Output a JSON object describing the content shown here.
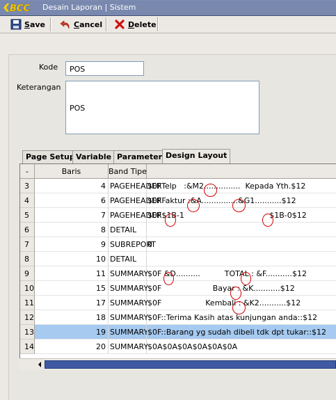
{
  "window": {
    "title": "Desain Laporan | Sistem",
    "logo_text": "BCC"
  },
  "toolbar": {
    "save_label": "Save",
    "save_mnemonic": "S",
    "save_rest": "ave",
    "cancel_mnemonic": "C",
    "cancel_rest": "ancel",
    "delete_mnemonic": "D",
    "delete_rest": "elete"
  },
  "form": {
    "kode_label": "Kode",
    "kode_value": "POS",
    "keterangan_label": "Keterangan",
    "keterangan_value": "POS"
  },
  "tabs": [
    {
      "label": "Page Setup",
      "active": false
    },
    {
      "label": "Variable",
      "active": false
    },
    {
      "label": "Parameter",
      "active": false
    },
    {
      "label": "Design Layout",
      "active": true
    }
  ],
  "grid": {
    "headers": {
      "rownum": "-",
      "baris": "Baris",
      "band": "Band Tipe",
      "text": ""
    },
    "rows": [
      {
        "n": "3",
        "baris": "4",
        "band": "PAGEHEADER",
        "text": "$0FTelp   :&M2...............  Kepada Yth.$12"
      },
      {
        "n": "4",
        "baris": "6",
        "band": "PAGEHEADER",
        "text": "$0FFaktur :&A...............&G1...........$12"
      },
      {
        "n": "5",
        "baris": "7",
        "band": "PAGEHEADER",
        "text": "$0F$1B-1                                   $1B-0$12"
      },
      {
        "n": "6",
        "baris": "8",
        "band": "DETAIL",
        "text": ""
      },
      {
        "n": "7",
        "baris": "9",
        "band": "SUBREPORT",
        "text": "0"
      },
      {
        "n": "8",
        "baris": "10",
        "band": "DETAIL",
        "text": ""
      },
      {
        "n": "9",
        "baris": "11",
        "band": "SUMMARY",
        "text": "$0F &D..........          TOTAL : &F...........$12"
      },
      {
        "n": "10",
        "baris": "15",
        "band": "SUMMARY",
        "text": "$0F                     Bayar : &K...........$12"
      },
      {
        "n": "11",
        "baris": "17",
        "band": "SUMMARY",
        "text": "$0F                  Kembali : &K2...........$12"
      },
      {
        "n": "12",
        "baris": "18",
        "band": "SUMMARY",
        "text": "$0F::Terima Kasih atas kunjungan anda::$12"
      },
      {
        "n": "13",
        "baris": "19",
        "band": "SUMMARY",
        "text": "$0F::Barang yg sudah dibeli tdk dpt tukar::$12",
        "selected": true
      },
      {
        "n": "14",
        "baris": "20",
        "band": "SUMMARY",
        "text": "$0A$0A$0A$0A$0A$0A"
      }
    ]
  },
  "colors": {
    "selection": "#a6caf0",
    "annotation_circle": "#d40000",
    "titlebar": "#7a89ad"
  }
}
